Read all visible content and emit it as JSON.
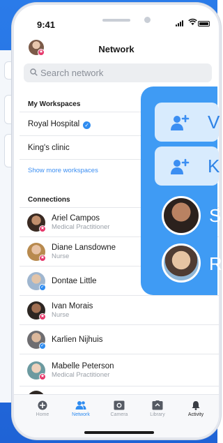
{
  "status": {
    "time": "9:41"
  },
  "header": {
    "title": "Network"
  },
  "search": {
    "placeholder": "Search network"
  },
  "workspaces": {
    "heading": "My Workspaces",
    "items": [
      {
        "label": "Royal Hospital",
        "verified": true
      },
      {
        "label": "King's clinic",
        "verified": false
      }
    ],
    "show_more": "Show more workspaces"
  },
  "connections": {
    "heading": "Connections",
    "items": [
      {
        "name": "Ariel Campos",
        "role": "Medical Practitioner",
        "badge": "star"
      },
      {
        "name": "Diane Lansdowne",
        "role": "Nurse",
        "badge": "star"
      },
      {
        "name": "Dontae Little",
        "role": "",
        "badge": "check"
      },
      {
        "name": "Ivan Morais",
        "role": "Nurse",
        "badge": "star"
      },
      {
        "name": "Karlien Nijhuis",
        "role": "",
        "badge": "check"
      },
      {
        "name": "Mabelle Peterson",
        "role": "Medical Practitioner",
        "badge": "star"
      }
    ]
  },
  "overlay": {
    "letters": [
      "V",
      "K",
      "S",
      "R"
    ]
  },
  "tabs": [
    {
      "label": "Home",
      "icon": "home-icon"
    },
    {
      "label": "Network",
      "icon": "people-icon"
    },
    {
      "label": "Camera",
      "icon": "camera-icon"
    },
    {
      "label": "Library",
      "icon": "library-icon"
    },
    {
      "label": "Activity",
      "icon": "bell-icon"
    }
  ],
  "colors": {
    "accent": "#2f8cf0",
    "badge_pink": "#e6376a",
    "overlay_blue": "#3f9bf4",
    "background_blue": "#2a7be9"
  }
}
